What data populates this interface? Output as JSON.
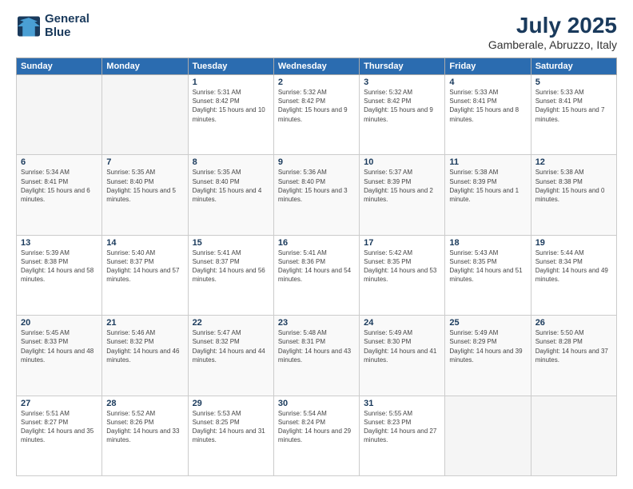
{
  "logo": {
    "line1": "General",
    "line2": "Blue"
  },
  "title": "July 2025",
  "subtitle": "Gamberale, Abruzzo, Italy",
  "weekdays": [
    "Sunday",
    "Monday",
    "Tuesday",
    "Wednesday",
    "Thursday",
    "Friday",
    "Saturday"
  ],
  "weeks": [
    [
      {
        "day": "",
        "sunrise": "",
        "sunset": "",
        "daylight": ""
      },
      {
        "day": "",
        "sunrise": "",
        "sunset": "",
        "daylight": ""
      },
      {
        "day": "1",
        "sunrise": "Sunrise: 5:31 AM",
        "sunset": "Sunset: 8:42 PM",
        "daylight": "Daylight: 15 hours and 10 minutes."
      },
      {
        "day": "2",
        "sunrise": "Sunrise: 5:32 AM",
        "sunset": "Sunset: 8:42 PM",
        "daylight": "Daylight: 15 hours and 9 minutes."
      },
      {
        "day": "3",
        "sunrise": "Sunrise: 5:32 AM",
        "sunset": "Sunset: 8:42 PM",
        "daylight": "Daylight: 15 hours and 9 minutes."
      },
      {
        "day": "4",
        "sunrise": "Sunrise: 5:33 AM",
        "sunset": "Sunset: 8:41 PM",
        "daylight": "Daylight: 15 hours and 8 minutes."
      },
      {
        "day": "5",
        "sunrise": "Sunrise: 5:33 AM",
        "sunset": "Sunset: 8:41 PM",
        "daylight": "Daylight: 15 hours and 7 minutes."
      }
    ],
    [
      {
        "day": "6",
        "sunrise": "Sunrise: 5:34 AM",
        "sunset": "Sunset: 8:41 PM",
        "daylight": "Daylight: 15 hours and 6 minutes."
      },
      {
        "day": "7",
        "sunrise": "Sunrise: 5:35 AM",
        "sunset": "Sunset: 8:40 PM",
        "daylight": "Daylight: 15 hours and 5 minutes."
      },
      {
        "day": "8",
        "sunrise": "Sunrise: 5:35 AM",
        "sunset": "Sunset: 8:40 PM",
        "daylight": "Daylight: 15 hours and 4 minutes."
      },
      {
        "day": "9",
        "sunrise": "Sunrise: 5:36 AM",
        "sunset": "Sunset: 8:40 PM",
        "daylight": "Daylight: 15 hours and 3 minutes."
      },
      {
        "day": "10",
        "sunrise": "Sunrise: 5:37 AM",
        "sunset": "Sunset: 8:39 PM",
        "daylight": "Daylight: 15 hours and 2 minutes."
      },
      {
        "day": "11",
        "sunrise": "Sunrise: 5:38 AM",
        "sunset": "Sunset: 8:39 PM",
        "daylight": "Daylight: 15 hours and 1 minute."
      },
      {
        "day": "12",
        "sunrise": "Sunrise: 5:38 AM",
        "sunset": "Sunset: 8:38 PM",
        "daylight": "Daylight: 15 hours and 0 minutes."
      }
    ],
    [
      {
        "day": "13",
        "sunrise": "Sunrise: 5:39 AM",
        "sunset": "Sunset: 8:38 PM",
        "daylight": "Daylight: 14 hours and 58 minutes."
      },
      {
        "day": "14",
        "sunrise": "Sunrise: 5:40 AM",
        "sunset": "Sunset: 8:37 PM",
        "daylight": "Daylight: 14 hours and 57 minutes."
      },
      {
        "day": "15",
        "sunrise": "Sunrise: 5:41 AM",
        "sunset": "Sunset: 8:37 PM",
        "daylight": "Daylight: 14 hours and 56 minutes."
      },
      {
        "day": "16",
        "sunrise": "Sunrise: 5:41 AM",
        "sunset": "Sunset: 8:36 PM",
        "daylight": "Daylight: 14 hours and 54 minutes."
      },
      {
        "day": "17",
        "sunrise": "Sunrise: 5:42 AM",
        "sunset": "Sunset: 8:35 PM",
        "daylight": "Daylight: 14 hours and 53 minutes."
      },
      {
        "day": "18",
        "sunrise": "Sunrise: 5:43 AM",
        "sunset": "Sunset: 8:35 PM",
        "daylight": "Daylight: 14 hours and 51 minutes."
      },
      {
        "day": "19",
        "sunrise": "Sunrise: 5:44 AM",
        "sunset": "Sunset: 8:34 PM",
        "daylight": "Daylight: 14 hours and 49 minutes."
      }
    ],
    [
      {
        "day": "20",
        "sunrise": "Sunrise: 5:45 AM",
        "sunset": "Sunset: 8:33 PM",
        "daylight": "Daylight: 14 hours and 48 minutes."
      },
      {
        "day": "21",
        "sunrise": "Sunrise: 5:46 AM",
        "sunset": "Sunset: 8:32 PM",
        "daylight": "Daylight: 14 hours and 46 minutes."
      },
      {
        "day": "22",
        "sunrise": "Sunrise: 5:47 AM",
        "sunset": "Sunset: 8:32 PM",
        "daylight": "Daylight: 14 hours and 44 minutes."
      },
      {
        "day": "23",
        "sunrise": "Sunrise: 5:48 AM",
        "sunset": "Sunset: 8:31 PM",
        "daylight": "Daylight: 14 hours and 43 minutes."
      },
      {
        "day": "24",
        "sunrise": "Sunrise: 5:49 AM",
        "sunset": "Sunset: 8:30 PM",
        "daylight": "Daylight: 14 hours and 41 minutes."
      },
      {
        "day": "25",
        "sunrise": "Sunrise: 5:49 AM",
        "sunset": "Sunset: 8:29 PM",
        "daylight": "Daylight: 14 hours and 39 minutes."
      },
      {
        "day": "26",
        "sunrise": "Sunrise: 5:50 AM",
        "sunset": "Sunset: 8:28 PM",
        "daylight": "Daylight: 14 hours and 37 minutes."
      }
    ],
    [
      {
        "day": "27",
        "sunrise": "Sunrise: 5:51 AM",
        "sunset": "Sunset: 8:27 PM",
        "daylight": "Daylight: 14 hours and 35 minutes."
      },
      {
        "day": "28",
        "sunrise": "Sunrise: 5:52 AM",
        "sunset": "Sunset: 8:26 PM",
        "daylight": "Daylight: 14 hours and 33 minutes."
      },
      {
        "day": "29",
        "sunrise": "Sunrise: 5:53 AM",
        "sunset": "Sunset: 8:25 PM",
        "daylight": "Daylight: 14 hours and 31 minutes."
      },
      {
        "day": "30",
        "sunrise": "Sunrise: 5:54 AM",
        "sunset": "Sunset: 8:24 PM",
        "daylight": "Daylight: 14 hours and 29 minutes."
      },
      {
        "day": "31",
        "sunrise": "Sunrise: 5:55 AM",
        "sunset": "Sunset: 8:23 PM",
        "daylight": "Daylight: 14 hours and 27 minutes."
      },
      {
        "day": "",
        "sunrise": "",
        "sunset": "",
        "daylight": ""
      },
      {
        "day": "",
        "sunrise": "",
        "sunset": "",
        "daylight": ""
      }
    ]
  ]
}
